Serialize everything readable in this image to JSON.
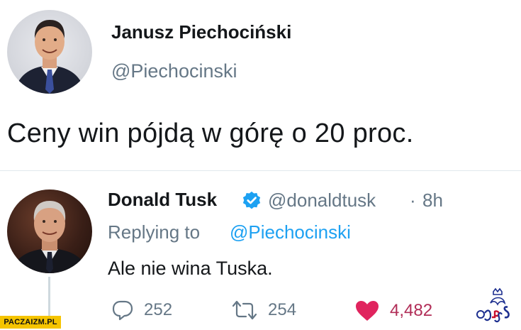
{
  "top_tweet": {
    "name": "Janusz Piechociński",
    "handle": "@Piechocinski",
    "text": "Ceny win pójdą w górę o 20 proc."
  },
  "reply_tweet": {
    "name": "Donald Tusk",
    "handle": "@donaldtusk",
    "separator": "·",
    "time": "8h",
    "replying_prefix": "Replying to",
    "replying_handle": "@Piechocinski",
    "text": "Ale nie wina Tuska."
  },
  "actions": {
    "replies": "252",
    "retweets": "254",
    "likes": "4,482"
  },
  "watermark": "PACZAIZM.PL",
  "colors": {
    "handle_gray": "#657786",
    "link_blue": "#1da1f2",
    "like_red": "#e0245e",
    "watermark_yellow": "#f5c400"
  },
  "icons": [
    "reply-icon",
    "retweet-icon",
    "heart-icon",
    "verified-badge-icon",
    "pis-logo-icon"
  ]
}
